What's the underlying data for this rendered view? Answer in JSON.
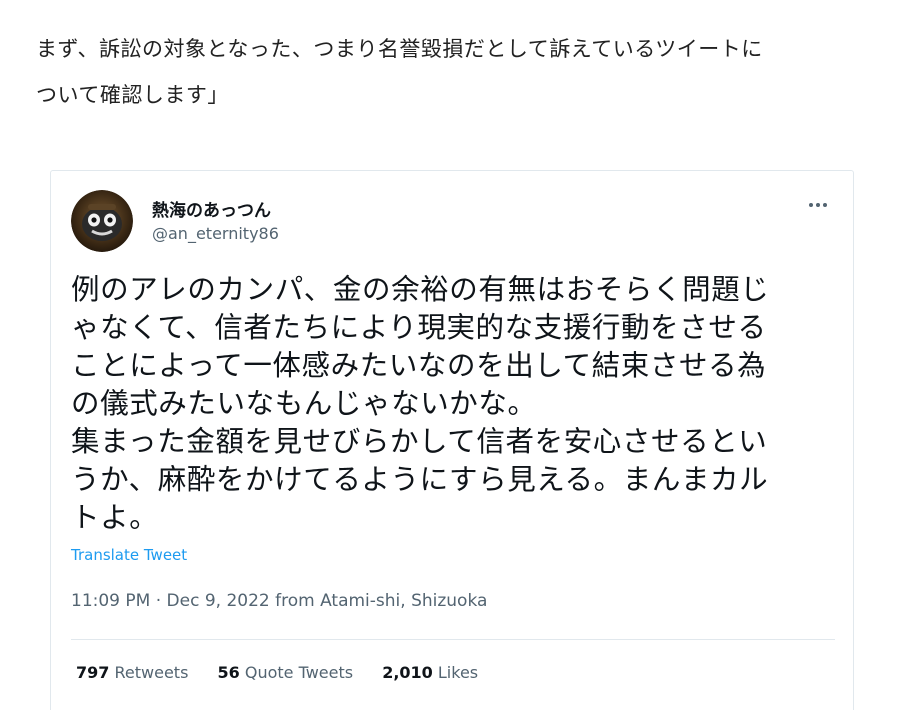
{
  "article": {
    "intro_line1": "まず、訴訟の対象となった、つまり名誉毀損だとして訴えているツイートに",
    "intro_line2": "ついて確認します」"
  },
  "tweet": {
    "author_name": "熱海のあっつん",
    "author_handle": "@an_eternity86",
    "more_icon": "more-dots-icon",
    "text_lines": [
      "例のアレのカンパ、金の余裕の有無はおそらく問題じ",
      "ゃなくて、信者たちにより現実的な支援行動をさせる",
      "ことによって一体感みたいなのを出して結束させる為",
      "の儀式みたいなもんじゃないかな。",
      "集まった金額を見せびらかして信者を安心させるとい",
      "うか、麻酔をかけてるようにすら見える。まんまカル",
      "トよ。"
    ],
    "translate_label": "Translate Tweet",
    "timestamp": "11:09 PM · Dec 9, 2022 from Atami-shi, Shizuoka",
    "stats": {
      "retweets_count": "797",
      "retweets_label": "Retweets",
      "quotes_count": "56",
      "quotes_label": "Quote Tweets",
      "likes_count": "2,010",
      "likes_label": "Likes"
    }
  },
  "colors": {
    "link": "#1d9bf0",
    "secondary_text": "#536471",
    "primary_text": "#0f1419",
    "border": "#e1e8ed"
  }
}
